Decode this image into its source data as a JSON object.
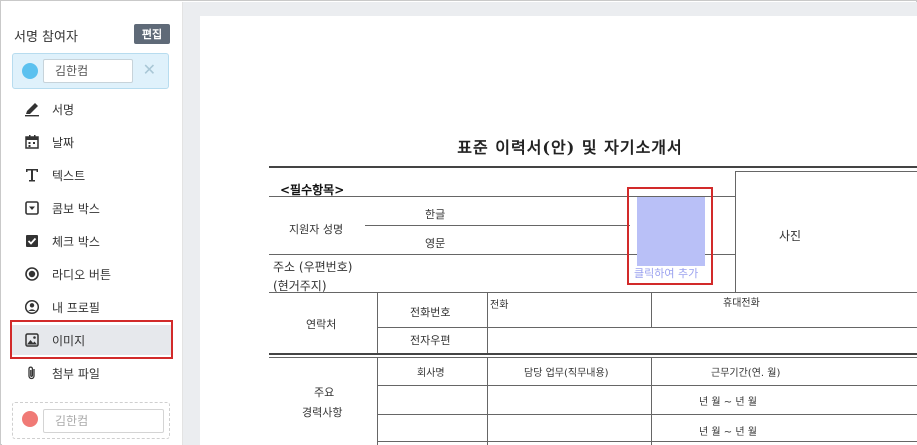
{
  "sidebar": {
    "title": "서명 참여자",
    "edit_label": "편집",
    "signers": [
      {
        "name": "김한컴",
        "color": "#5cc1ef",
        "remove_symbol": "✕"
      },
      {
        "name": "김한컴",
        "color": "#f07a76"
      }
    ],
    "tools": [
      {
        "label": "서명",
        "icon": "pen-icon"
      },
      {
        "label": "날짜",
        "icon": "calendar-icon"
      },
      {
        "label": "텍스트",
        "icon": "text-icon"
      },
      {
        "label": "콤보 박스",
        "icon": "combo-box-icon"
      },
      {
        "label": "체크 박스",
        "icon": "checkbox-icon"
      },
      {
        "label": "라디오 버튼",
        "icon": "radio-icon"
      },
      {
        "label": "내 프로필",
        "icon": "profile-icon"
      },
      {
        "label": "이미지",
        "icon": "image-icon",
        "selected": true
      },
      {
        "label": "첨부 파일",
        "icon": "paperclip-icon"
      }
    ]
  },
  "document": {
    "title": "표준 이력서(안) 및 자기소개서",
    "required_section": "<필수항목>",
    "applicant_name": "지원자 성명",
    "name_korean": "한글",
    "name_english": "영문",
    "address": "주소 (우편번호)",
    "current_residence": "(현거주지)",
    "photo": "사진",
    "contact": "연락처",
    "phone_number": "전화번호",
    "phone": "전화",
    "mobile": "휴대전화",
    "email": "전자우편",
    "career": "주요",
    "career2": "경력사항",
    "company": "회사명",
    "duty": "담당 업무(직무내용)",
    "period": "근무기간(연. 월)",
    "period_range": "년   월 ~ 년   월",
    "image_field_caption": "클릭하여 추가"
  }
}
